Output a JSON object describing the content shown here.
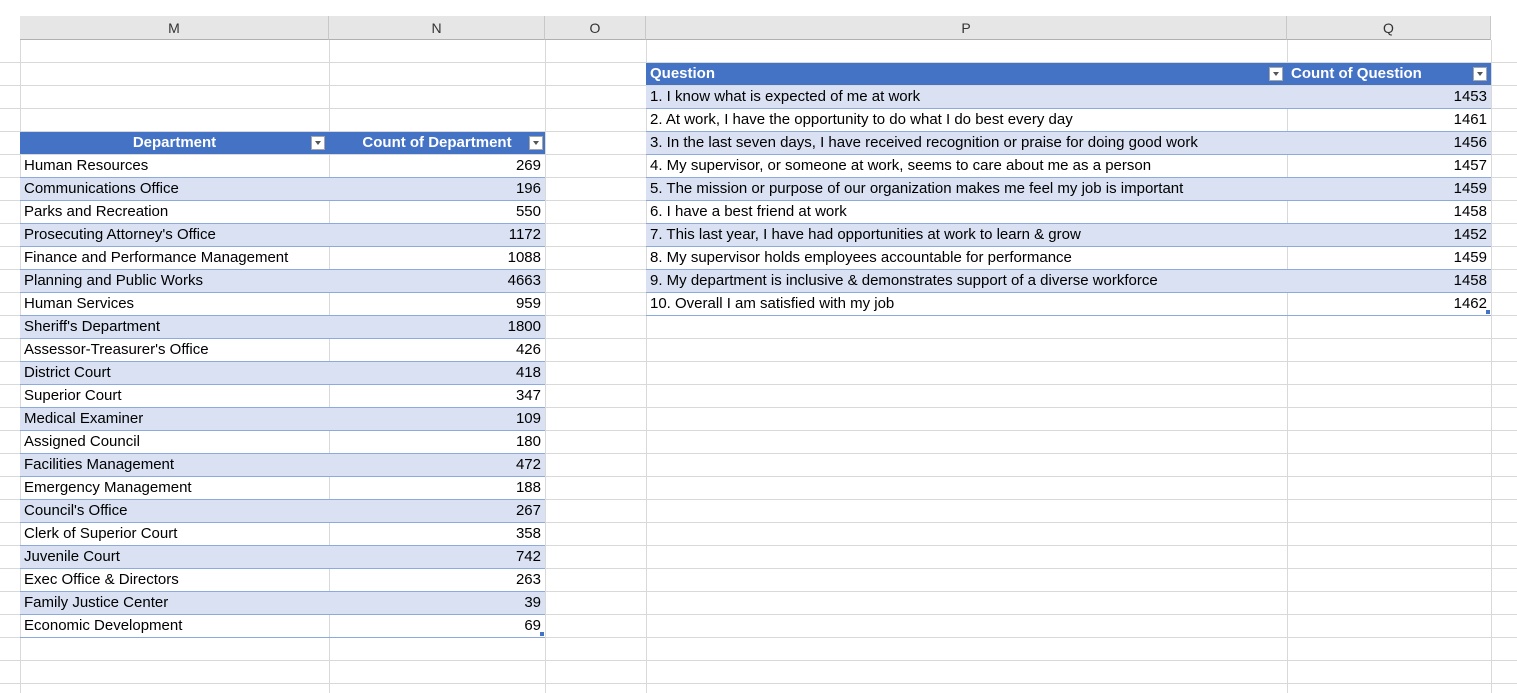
{
  "columns": [
    "M",
    "N",
    "O",
    "P",
    "Q"
  ],
  "department_table": {
    "header_department": "Department",
    "header_count": "Count of Department",
    "rows": [
      {
        "name": "Human Resources",
        "count": "269"
      },
      {
        "name": "Communications Office",
        "count": "196"
      },
      {
        "name": "Parks and Recreation",
        "count": "550"
      },
      {
        "name": "Prosecuting Attorney's Office",
        "count": "1172"
      },
      {
        "name": "Finance and Performance Management",
        "count": "1088"
      },
      {
        "name": "Planning and Public Works",
        "count": "4663"
      },
      {
        "name": "Human Services",
        "count": "959"
      },
      {
        "name": "Sheriff's Department",
        "count": "1800"
      },
      {
        "name": "Assessor-Treasurer's Office",
        "count": "426"
      },
      {
        "name": "District Court",
        "count": "418"
      },
      {
        "name": "Superior Court",
        "count": "347"
      },
      {
        "name": "Medical Examiner",
        "count": "109"
      },
      {
        "name": "Assigned Council",
        "count": "180"
      },
      {
        "name": "Facilities Management",
        "count": "472"
      },
      {
        "name": "Emergency Management",
        "count": "188"
      },
      {
        "name": "Council's Office",
        "count": "267"
      },
      {
        "name": "Clerk of Superior Court",
        "count": "358"
      },
      {
        "name": "Juvenile Court",
        "count": "742"
      },
      {
        "name": "Exec Office & Directors",
        "count": "263"
      },
      {
        "name": "Family Justice Center",
        "count": "39"
      },
      {
        "name": "Economic Development",
        "count": "69"
      }
    ]
  },
  "question_table": {
    "header_question": "Question",
    "header_count": "Count of Question",
    "rows": [
      {
        "question": "1. I know what is expected of me at work",
        "count": "1453"
      },
      {
        "question": "2. At work, I have the opportunity to do what I do best every day",
        "count": "1461"
      },
      {
        "question": "3. In the last seven days, I have received recognition or praise for doing good work",
        "count": "1456"
      },
      {
        "question": "4. My supervisor, or someone at work, seems to care about me as a person",
        "count": "1457"
      },
      {
        "question": "5. The mission or purpose of our organization makes me feel my job is important",
        "count": "1459"
      },
      {
        "question": "6. I have a best friend at work",
        "count": "1458"
      },
      {
        "question": "7. This last year, I have had opportunities at work to learn & grow",
        "count": "1452"
      },
      {
        "question": "8. My supervisor holds employees accountable for performance",
        "count": "1459"
      },
      {
        "question": "9. My department is inclusive & demonstrates support of a diverse workforce",
        "count": "1458"
      },
      {
        "question": "10. Overall I am satisfied with my job",
        "count": "1462"
      }
    ]
  },
  "colors": {
    "header_fill": "#4472c4",
    "band_fill": "#d9e1f2",
    "gridline": "#d9d9d9"
  }
}
